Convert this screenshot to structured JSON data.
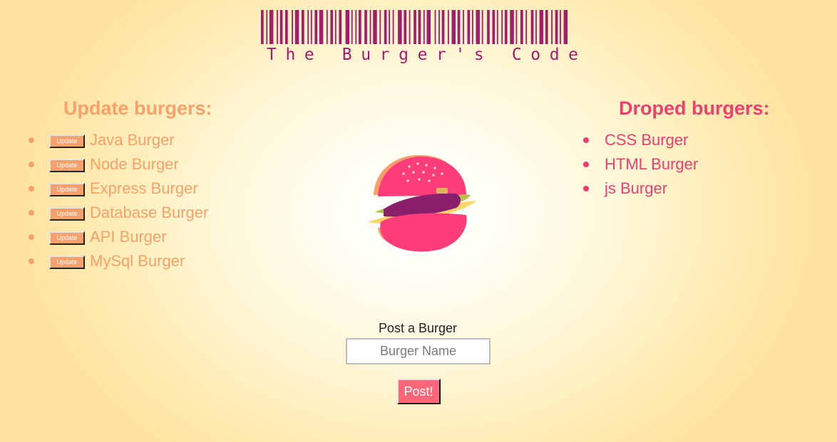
{
  "header": {
    "title": "The Burger's Code"
  },
  "update_section": {
    "heading": "Update burgers:",
    "button_label": "Update",
    "items": [
      {
        "name": "Java Burger"
      },
      {
        "name": "Node Burger"
      },
      {
        "name": "Express Burger"
      },
      {
        "name": "Database Burger"
      },
      {
        "name": "API Burger"
      },
      {
        "name": "MySql Burger"
      }
    ]
  },
  "dropped_section": {
    "heading": "Droped burgers:",
    "items": [
      {
        "name": "CSS Burger"
      },
      {
        "name": "HTML Burger"
      },
      {
        "name": "js Burger"
      }
    ]
  },
  "post_form": {
    "label": "Post a Burger",
    "input_placeholder": "Burger Name",
    "input_value": "",
    "submit_label": "Post!"
  },
  "colors": {
    "update_accent": "#f9a16a",
    "dropped_accent": "#ef3f72",
    "barcode": "#a21d6e",
    "post_button": "#ff6678"
  },
  "icons": {
    "logo": "barcode-icon",
    "illustration": "burger-icon"
  }
}
